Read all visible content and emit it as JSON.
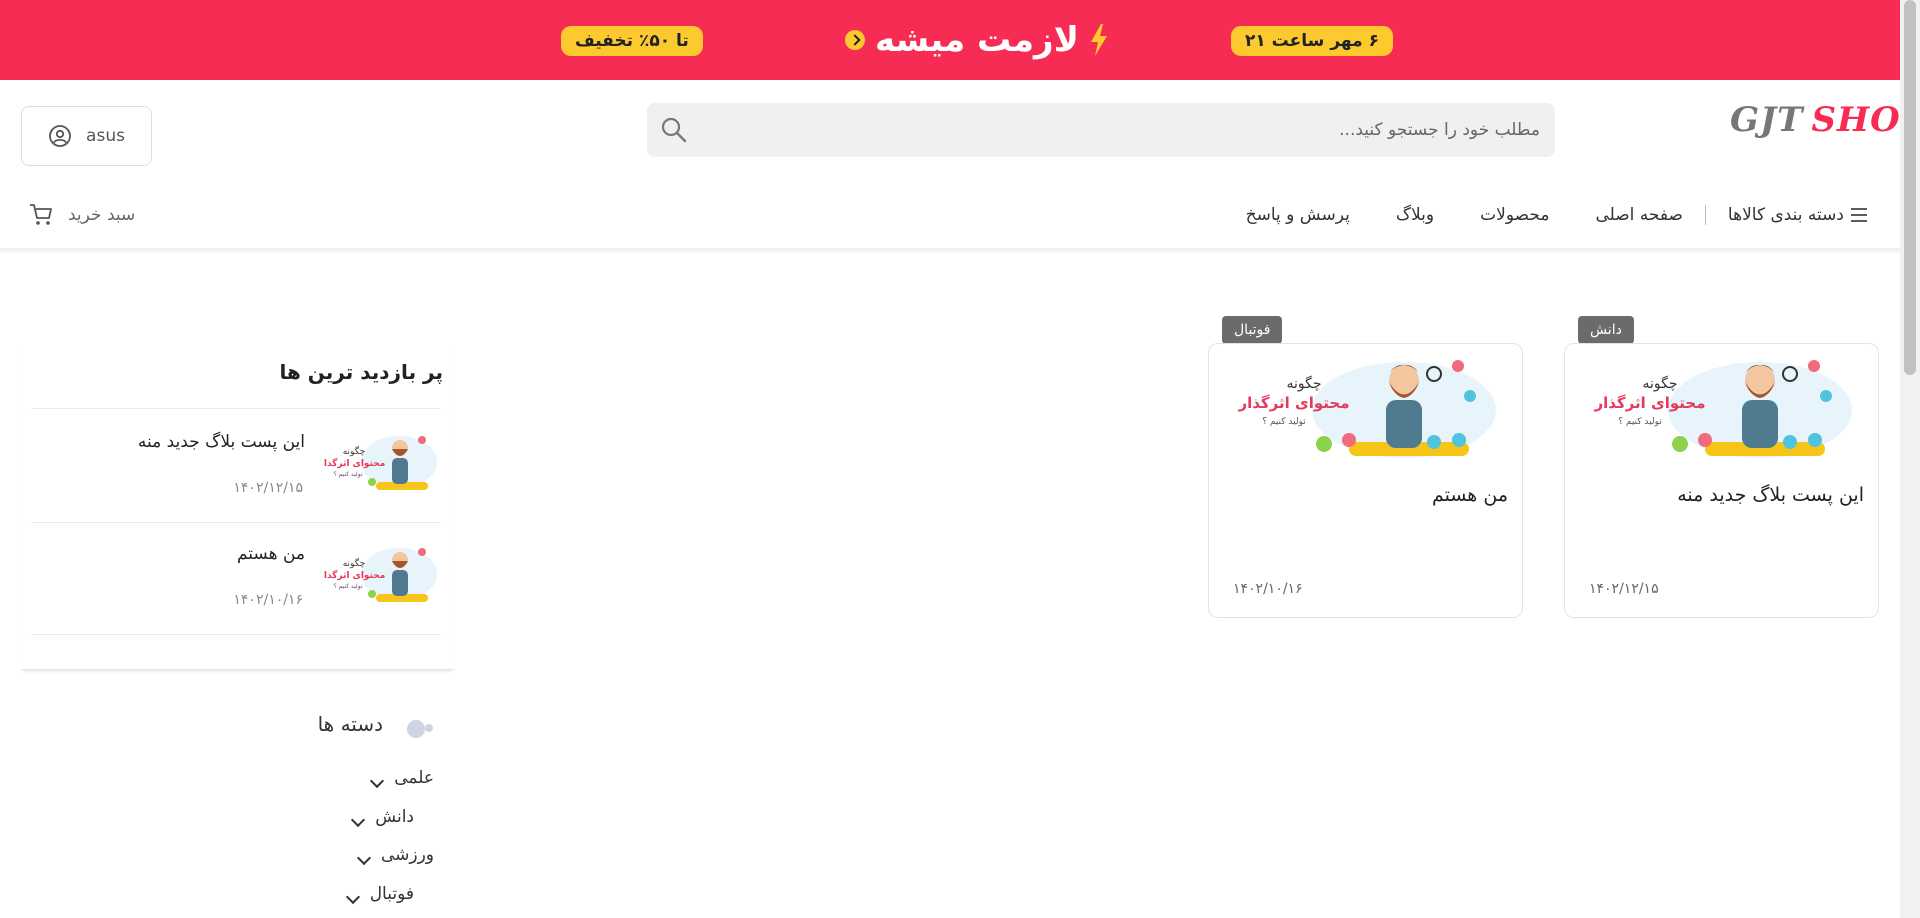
{
  "promo": {
    "discount_pill": "تا ۵۰٪ تخفیف",
    "title": "لازمت میشه",
    "date_pill": "۶ مهر ساعت ۲۱",
    "bg_color": "#f62c55",
    "pill_color": "#fcca2f"
  },
  "header": {
    "logo_part1": "GJT",
    "logo_part2": "SHOP",
    "search_placeholder": "مطلب خود را جستجو کنید...",
    "user_label": "asus"
  },
  "nav": {
    "categories_label": "دسته بندی کالاها",
    "items": [
      "صفحه اصلی",
      "محصولات",
      "وبلاگ",
      "پرسش و پاسخ"
    ],
    "cart_label": "سبد خرید"
  },
  "posts": [
    {
      "badge": "دانش",
      "title": "این پست بلاگ جدید منه",
      "date": "۱۴۰۲/۱۲/۱۵",
      "thumb_line1": "چگونه",
      "thumb_line2": "محتوای اثرگذار",
      "thumb_line3": "تولید کنیم ؟"
    },
    {
      "badge": "فوتبال",
      "title": "من هستم",
      "date": "۱۴۰۲/۱۰/۱۶",
      "thumb_line1": "چگونه",
      "thumb_line2": "محتوای اثرگذار",
      "thumb_line3": "تولید کنیم ؟"
    }
  ],
  "sidebar": {
    "popular_title": "پر بازدید ترین ها",
    "popular": [
      {
        "title": "این پست بلاگ جدید منه",
        "date": "۱۴۰۲/۱۲/۱۵",
        "thumb_line1": "چگونه",
        "thumb_line2": "محتوای اثرگذار",
        "thumb_line3": "تولید کنیم ؟"
      },
      {
        "title": "من هستم",
        "date": "۱۴۰۲/۱۰/۱۶",
        "thumb_line1": "چگونه",
        "thumb_line2": "محتوای اثرگذار",
        "thumb_line3": "تولید کنیم ؟"
      }
    ],
    "categories_title": "دسته ها",
    "categories": [
      "علمی",
      "دانش",
      "ورزشی",
      "فوتبال"
    ]
  }
}
